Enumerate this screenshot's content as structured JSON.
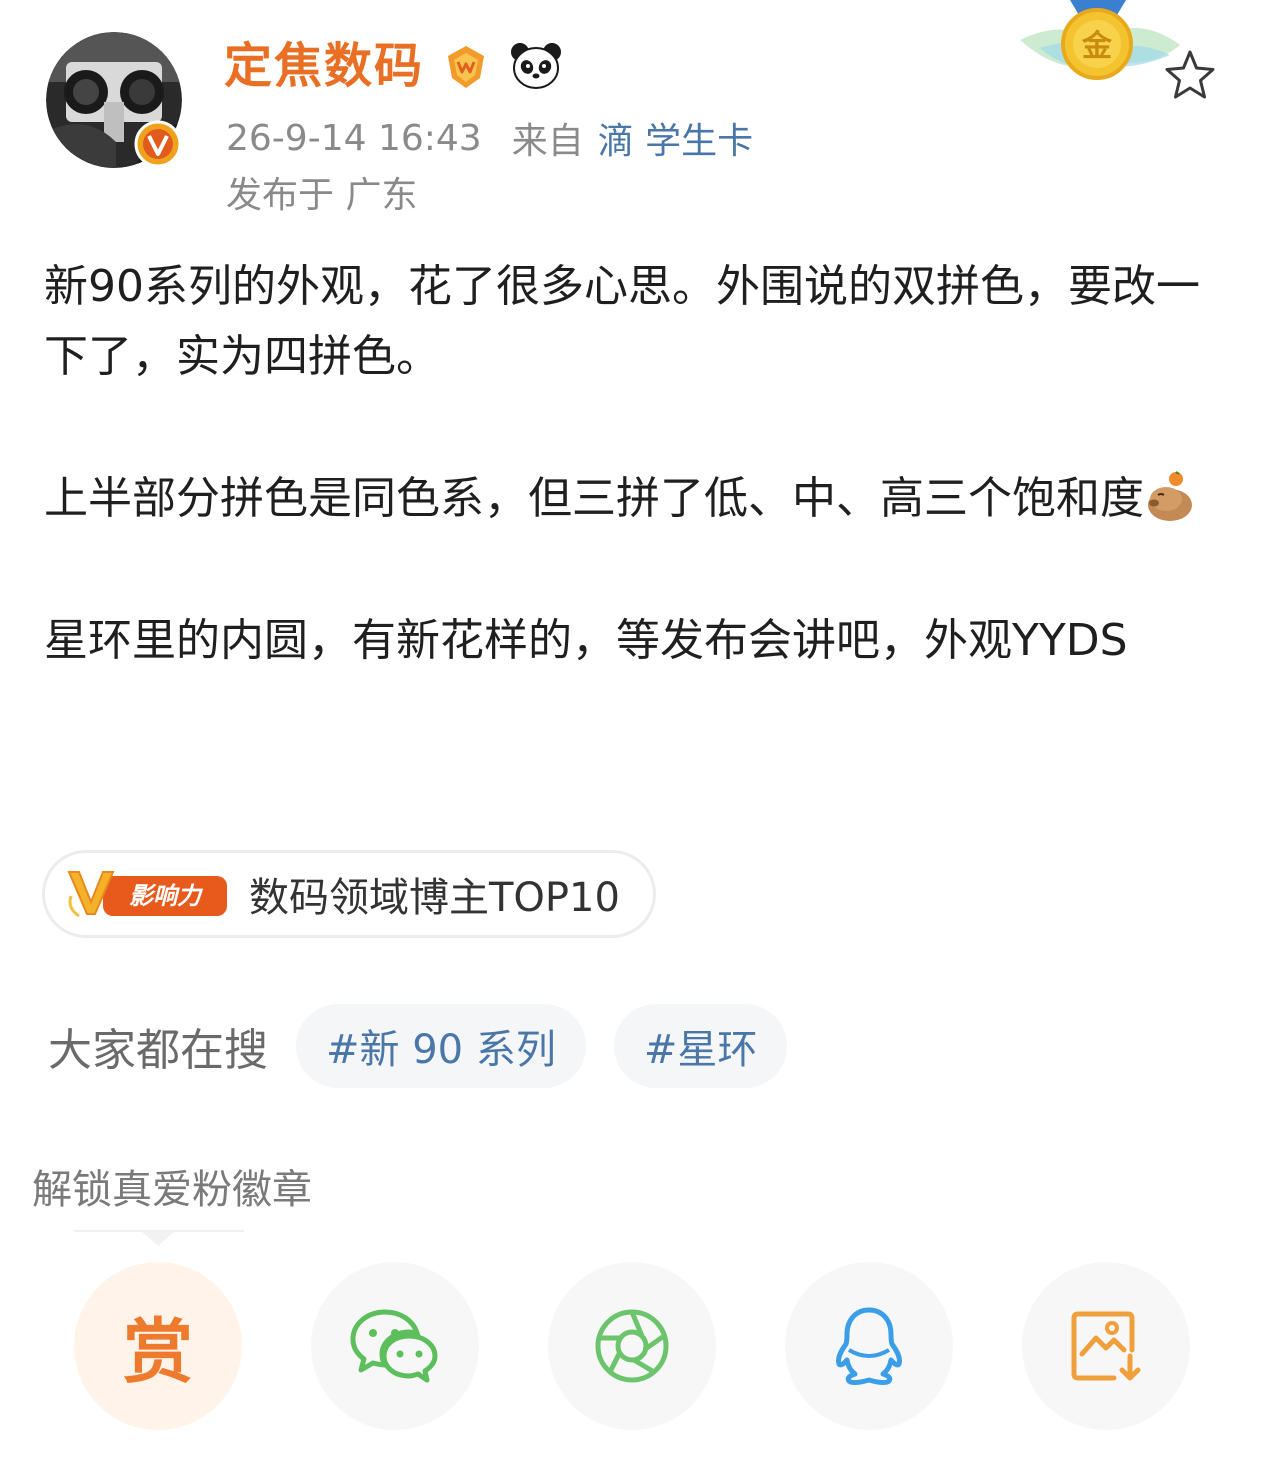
{
  "header": {
    "username": "定焦数码",
    "timestamp": "26-9-14 16:43",
    "source_prefix": "来自",
    "source_device": "滴 学生卡",
    "location": "发布于 广东"
  },
  "post": {
    "paragraphs": [
      "新90系列的外观，花了很多心思。外围说的双拼色，要改一下了，实为四拼色。",
      "上半部分拼色是同色系，但三拼了低、中、高三个饱和度",
      "星环里的内圆，有新花样的，等发布会讲吧，外观YYDS"
    ]
  },
  "influence": {
    "logo_text": "影响力",
    "label": "数码领域博主TOP10"
  },
  "hot_search": {
    "label": "大家都在搜",
    "tags": [
      "#新 90 系列",
      "#星环"
    ]
  },
  "fan_badge": {
    "label": "解锁真爱粉徽章"
  },
  "share": {
    "reward_glyph": "赏",
    "items": [
      "reward-icon",
      "wechat-icon",
      "moments-icon",
      "qq-icon",
      "save-image-icon"
    ]
  },
  "colors": {
    "username": "#e86f23",
    "link": "#4a76a8",
    "meta": "#8a8a8a",
    "reward": "#ee7b2d",
    "wechat": "#5cbf5c",
    "qq": "#3a9fe8",
    "save": "#f0a03a"
  }
}
